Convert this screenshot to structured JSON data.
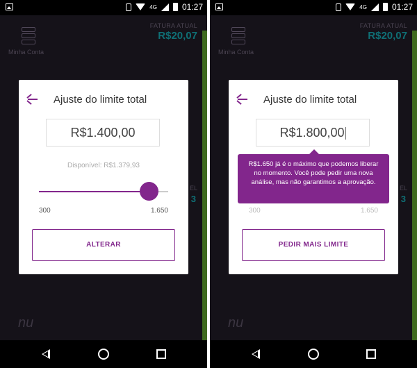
{
  "status_bar": {
    "network": "4G",
    "time": "01:27"
  },
  "background": {
    "account_label": "Minha Conta",
    "fatura_label": "FATURA ATUAL",
    "fatura_value": "R$20,07",
    "fragment_el": "EL",
    "fragment_3": "3"
  },
  "left": {
    "card_title": "Ajuste do limite total",
    "value": "R$1.400,00",
    "disponivel": "Disponível: R$1.379,93",
    "slider_min": "300",
    "slider_max": "1.650",
    "slider_fraction": 0.85,
    "button_label": "ALTERAR"
  },
  "right": {
    "card_title": "Ajuste do limite total",
    "value": "R$1.800,00",
    "tooltip": "R$1.650 já é o máximo que podemos liberar no momento. Você pode pedir uma nova análise, mas não garantimos a aprovação.",
    "slider_min": "300",
    "slider_max": "1.650",
    "button_label": "PEDIR MAIS LIMITE"
  },
  "colors": {
    "accent": "#82268c",
    "teal": "#0f6f75",
    "green": "#3f6a1f"
  },
  "icons": [
    "image-icon",
    "vibrate-icon",
    "wifi-icon",
    "signal-icon",
    "battery-icon",
    "server-icon",
    "back-arrow-icon",
    "nav-back-icon",
    "nav-home-icon",
    "nav-recent-icon",
    "nu-logo-icon"
  ]
}
